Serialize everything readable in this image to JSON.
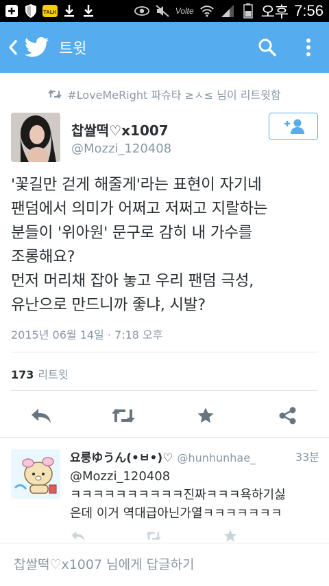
{
  "status_bar": {
    "carrier_label": "오후",
    "time": "7:56",
    "lte_label": "Volte",
    "talk_label": "TALK",
    "battery_level": 0.45
  },
  "app_bar": {
    "title": "트윗",
    "back_icon": "chevron-left-icon",
    "logo_icon": "twitter-bird-icon",
    "search_icon": "search-icon",
    "menu_icon": "overflow-menu-icon"
  },
  "retweet_context": {
    "text": "#LoveMeRight 파슈타 ≥ㅅ≤ 님이 리트윗함"
  },
  "tweet": {
    "author_name": "찹쌀떡♡x1007",
    "author_handle": "@Mozzi_120408",
    "text_lines": [
      "'꽃길만 걷게 해줄게'라는 표현이 자기네",
      "팬덤에서 의미가 어쩌고 저쩌고 지랄하는",
      "분들이 '위아원' 문구로 감히 내 가수를",
      "조롱해요?",
      "먼저 머리채 잡아 놓고 우리 팬덤 극성,",
      "유난으로 만드니까 좋냐, 시발?"
    ],
    "date": "2015년 06월 14일 · 7:18 오후",
    "retweet_count": "173",
    "retweet_label": "리트윗"
  },
  "reply": {
    "name": "요룽ゆうん(•ㅂ•)♡",
    "handle": "@hunhunhae_",
    "time": "33분",
    "text_lines": [
      "@Mozzi_120408",
      "ㅋㅋㅋㅋㅋㅋㅋㅋㅋㅋ진짜ㅋㅋㅋ욕하기싫",
      "은데 이거 역대급아닌가열ㅋㅋㅋㅋㅋㅋㅋ"
    ]
  },
  "composer": {
    "placeholder": "찹쌀떡♡x1007 님에게 답글하기"
  },
  "colors": {
    "brand": "#55acee",
    "text": "#292f33",
    "muted": "#8899a6",
    "divider": "#e1e8ed",
    "action_icon": "#66757f"
  }
}
